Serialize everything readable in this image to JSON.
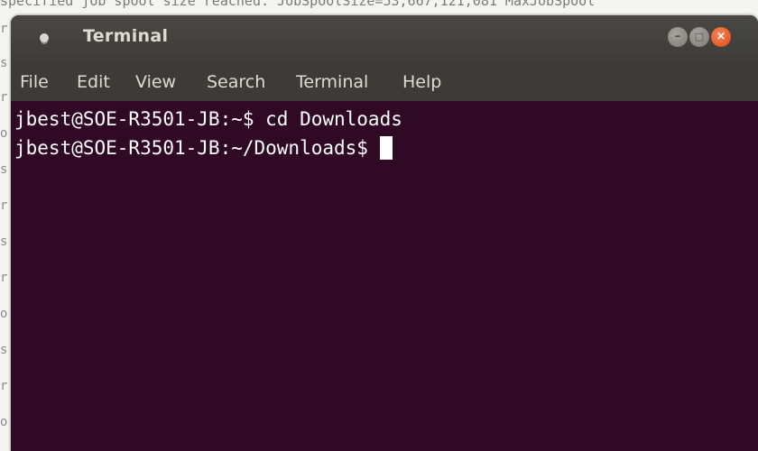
{
  "background": {
    "top_text": "specified job spool size reached. JobSpoolSize=53,667,121,081 MaxJobSpool",
    "edge_chars": [
      "r",
      "s",
      "r",
      "o",
      "s",
      "r",
      "s",
      "r",
      "o",
      "s",
      "r",
      "o"
    ]
  },
  "window": {
    "title": "Terminal",
    "icon": "terminal-app-icon",
    "controls": {
      "minimize": {
        "glyph": "–",
        "icon": "minimize-icon"
      },
      "maximize": {
        "glyph": "□",
        "icon": "maximize-icon"
      },
      "close": {
        "glyph": "×",
        "icon": "close-icon"
      }
    }
  },
  "menu": {
    "items": [
      "File",
      "Edit",
      "View",
      "Search",
      "Terminal",
      "Help"
    ]
  },
  "terminal": {
    "lines": [
      "jbest@SOE-R3501-JB:~$ cd Downloads",
      "jbest@SOE-R3501-JB:~/Downloads$ "
    ]
  },
  "colors": {
    "terminal_bg": "#300a24",
    "titlebar_bg": "#3c3b37",
    "close_button": "#df4b14",
    "text": "#ffffff"
  }
}
